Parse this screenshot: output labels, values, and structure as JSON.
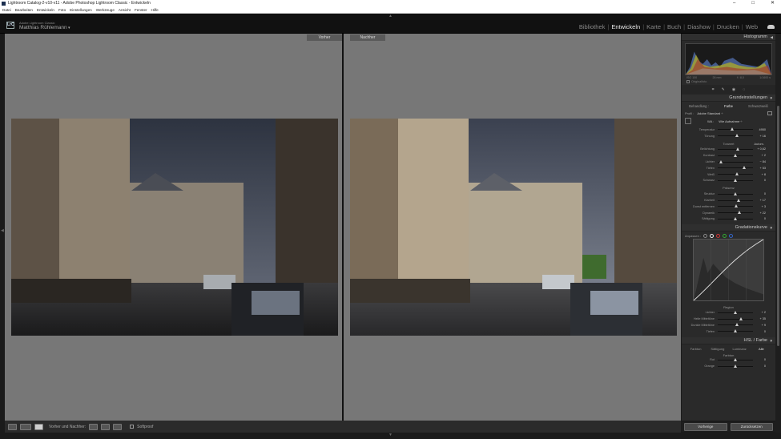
{
  "window": {
    "title": "Lightroom Catalog-2-v10-v11 - Adobe Photoshop Lightroom Classic - Entwickeln",
    "controls": [
      "–",
      "□",
      "✕"
    ]
  },
  "menu": [
    "Datei",
    "Bearbeiten",
    "Entwickeln",
    "Foto",
    "Einstellungen",
    "Werkzeuge",
    "Ansicht",
    "Fenster",
    "Hilfe"
  ],
  "identity": {
    "logo": "LrC",
    "catalog": "Adobe Lightroom Classic",
    "user": "Matthias Rühlemann",
    "caret": "▾"
  },
  "modules": {
    "items": [
      {
        "label": "Bibliothek",
        "active": false
      },
      {
        "label": "Entwickeln",
        "active": true
      },
      {
        "label": "Karte",
        "active": false
      },
      {
        "label": "Buch",
        "active": false
      },
      {
        "label": "Diashow",
        "active": false
      },
      {
        "label": "Drucken",
        "active": false
      },
      {
        "label": "Web",
        "active": false
      }
    ],
    "separator": "|"
  },
  "compare": {
    "before_label": "Vorher",
    "after_label": "Nachher"
  },
  "toolbar": {
    "mode_label": "Vorher und Nachher:",
    "softproof_label": "Softproof"
  },
  "panels": {
    "histogram": {
      "title": "Histogramm",
      "info": [
        "ISO 100",
        "26 mm",
        "f / 8,0",
        "1/1600 s"
      ],
      "original_photo": "Originalfoto"
    },
    "basic": {
      "title": "Grundeinstellungen",
      "treatment_label": "Behandlung :",
      "treatment_options": [
        {
          "label": "Farbe",
          "on": true
        },
        {
          "label": "Schwarzweiß",
          "on": false
        }
      ],
      "profile_label": "Profil :",
      "profile_value": "Adobe Standard ÷",
      "wb_label": "WA :",
      "wb_value": "Wie Aufnahme ÷",
      "sliders_wb": [
        {
          "label": "Temperatur",
          "value": "4950",
          "pos": 0.42
        },
        {
          "label": "Tönung",
          "value": "+ 16",
          "pos": 0.55
        }
      ],
      "tone_title": "Tonwert",
      "tone_auto": "Autom.",
      "sliders_tone": [
        {
          "label": "Belichtung",
          "value": "+ 0,62",
          "pos": 0.56
        },
        {
          "label": "Kontrast",
          "value": "+ 2",
          "pos": 0.51
        },
        {
          "label": "Lichter",
          "value": "− 84",
          "pos": 0.08
        },
        {
          "label": "Tiefen",
          "value": "+ 53",
          "pos": 0.76
        },
        {
          "label": "Weiß",
          "value": "+ 8",
          "pos": 0.54
        },
        {
          "label": "Schwarz",
          "value": "0",
          "pos": 0.5
        }
      ],
      "presence_title": "Präsenz",
      "sliders_presence": [
        {
          "label": "Struktur",
          "value": "0",
          "pos": 0.5
        },
        {
          "label": "Klarheit",
          "value": "+ 17",
          "pos": 0.58
        },
        {
          "label": "Dunst entfernen",
          "value": "+ 3",
          "pos": 0.52
        },
        {
          "label": "Dynamik",
          "value": "+ 22",
          "pos": 0.61
        },
        {
          "label": "Sättigung",
          "value": "0",
          "pos": 0.5
        }
      ]
    },
    "tone_curve": {
      "title": "Gradationskurve",
      "adjust_label": "Anpassen :",
      "region_title": "Region",
      "sliders": [
        {
          "label": "Lichter",
          "value": "+ 2",
          "pos": 0.51
        },
        {
          "label": "Helle Mitteltöne",
          "value": "+ 35",
          "pos": 0.67
        },
        {
          "label": "Dunkle Mitteltöne",
          "value": "+ 9",
          "pos": 0.54
        },
        {
          "label": "Tiefen",
          "value": "0",
          "pos": 0.5
        }
      ]
    },
    "hsl": {
      "title": "HSL / Farbe",
      "tabs": [
        {
          "label": "Farbton",
          "on": false
        },
        {
          "label": "Sättigung",
          "on": false
        },
        {
          "label": "Luminanz",
          "on": false
        },
        {
          "label": "Alle",
          "on": true
        }
      ],
      "section": "Farbton",
      "sliders": [
        {
          "label": "Rot",
          "value": "0",
          "pos": 0.5
        },
        {
          "label": "Orange",
          "value": "0",
          "pos": 0.5
        }
      ]
    }
  },
  "buttons": {
    "previous": "Vorherige",
    "reset": "Zurücksetzen"
  },
  "colors": {
    "accent": "#eaeaea",
    "panel_bg": "#2a2a2a",
    "canvas_bg": "#777777"
  }
}
